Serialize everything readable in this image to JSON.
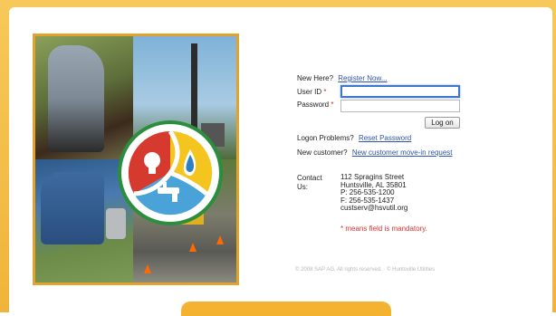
{
  "colors": {
    "frame": "#f0b43a",
    "link": "#2f54a8",
    "required": "#d21e1e",
    "focus_border": "#3f78c8"
  },
  "logo": {
    "icons": [
      "lightbulb-icon",
      "water-drop-icon",
      "faucet-icon"
    ]
  },
  "form": {
    "new_here_label": "New Here?",
    "register_link": "Register Now...",
    "user_id_label": "User ID",
    "password_label": "Password",
    "required_marker": "*",
    "user_id_value": "",
    "password_value": "",
    "logon_button": "Log on",
    "logon_problems_label": "Logon Problems?",
    "reset_password_link": "Reset Password",
    "new_customer_label": "New customer?",
    "move_in_link": "New customer move-in request"
  },
  "contact": {
    "label": "Contact Us:",
    "street": "112 Spragins Street",
    "city": "Huntsville, AL 35801",
    "phone": "P: 256-535-1200",
    "fax": "F: 256-535-1437",
    "email": "custserv@hsvutil.org"
  },
  "mandatory_note": "* means field is mandatory.",
  "footer": {
    "copyright": "© 2008 SAP AG. All rights reserved. · © Huntsville Utilities"
  }
}
